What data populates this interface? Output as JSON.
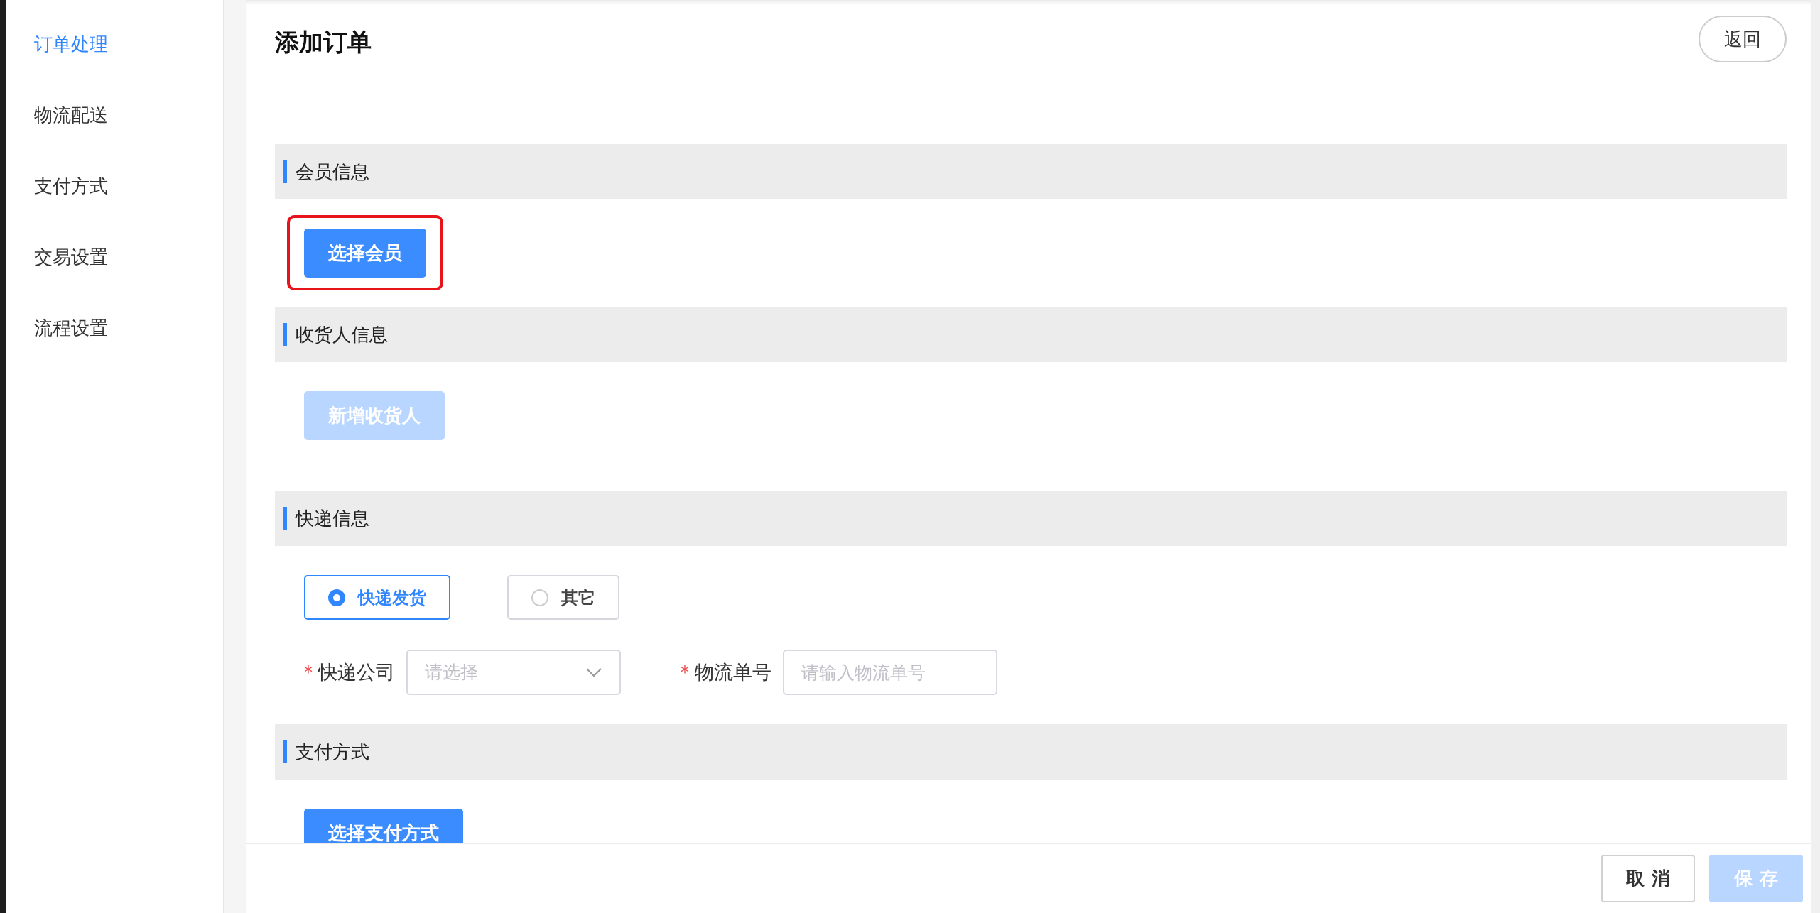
{
  "sidebar": {
    "items": [
      {
        "label": "订单处理",
        "selected": true
      },
      {
        "label": "物流配送",
        "selected": false
      },
      {
        "label": "支付方式",
        "selected": false
      },
      {
        "label": "交易设置",
        "selected": false
      },
      {
        "label": "流程设置",
        "selected": false
      }
    ]
  },
  "page": {
    "title": "添加订单",
    "back_button": "返回"
  },
  "sections": [
    {
      "title": "会员信息",
      "kind": "button",
      "button": {
        "label": "选择会员",
        "disabled": false,
        "highlighted": true
      }
    },
    {
      "title": "收货人信息",
      "kind": "button",
      "button": {
        "label": "新增收货人",
        "disabled": true
      }
    },
    {
      "title": "快递信息",
      "kind": "shipping",
      "options": [
        {
          "label": "快递发货",
          "selected": true
        },
        {
          "label": "其它",
          "selected": false
        }
      ],
      "fields": [
        {
          "kind": "select",
          "required_mark": "*",
          "label": "快递公司",
          "placeholder": "请选择"
        },
        {
          "kind": "input",
          "required_mark": "*",
          "label": "物流单号",
          "placeholder": "请输入物流单号"
        }
      ]
    },
    {
      "title": "支付方式",
      "kind": "button",
      "button": {
        "label": "选择支付方式",
        "disabled": false
      }
    }
  ],
  "footer": {
    "buttons": [
      {
        "label": "取 消",
        "kind": "default",
        "disabled": false
      },
      {
        "label": "保 存",
        "kind": "primary",
        "disabled": true
      }
    ]
  }
}
